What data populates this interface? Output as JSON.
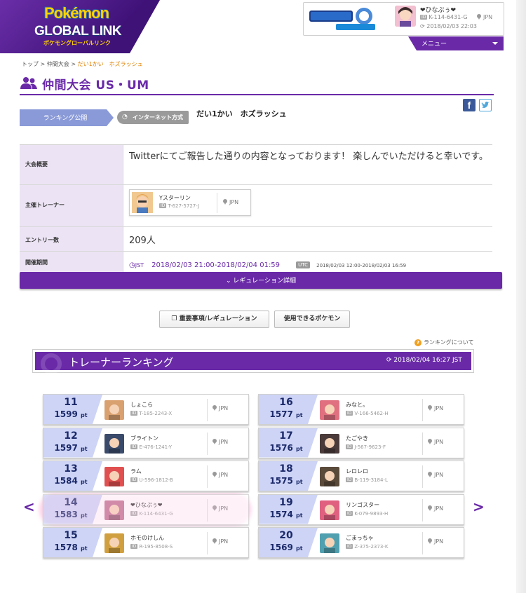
{
  "header": {
    "logo_top": "Pokémon",
    "logo_main": "GLOBAL LINK",
    "logo_sub": "ポケモングローバルリンク",
    "user": {
      "name": "❤ひなぷぅ❤",
      "id": "K-114-6431-G",
      "country": "JPN",
      "timestamp": "2018/02/03 22:03",
      "id_tag": "ID"
    },
    "menu_label": "メニュー"
  },
  "breadcrumb": {
    "top": "トップ",
    "sep": ">",
    "section": "仲間大会",
    "current": "だい1かい　ホズラッシュ"
  },
  "page": {
    "title": "仲間大会 US・UM"
  },
  "status": {
    "ranking_public": "ランキング公開",
    "network": "インターネット方式",
    "competition_name": "だい1かい　ホズラッシュ",
    "facebook": "f"
  },
  "info": {
    "overview_label": "大会概要",
    "overview": "Twitterにてご報告した通りの内容となっております！ 楽しんでいただけると幸いです。",
    "host_label": "主催トレーナー",
    "host": {
      "name": "Yスターリン",
      "id": "T-627-5727-J",
      "country": "JPN",
      "id_tag": "ID"
    },
    "entries_label": "エントリー数",
    "entries": "209人",
    "period_label": "開催期間",
    "period_jst_tag": "JST",
    "period_jst": "2018/02/03 21:00-2018/02/04 01:59",
    "period_utc_tag": "UTC",
    "period_utc": "2018/02/03 12:00-2018/02/03 16:59"
  },
  "regulation_detail": "レギュレーション詳細",
  "buttons": {
    "important": "重要事項/レギュレーション",
    "usable_pokemon": "使用できるポケモン"
  },
  "ranking": {
    "about": "ランキングについて",
    "title": "トレーナーランキング",
    "updated": "2018/02/04 16:27",
    "updated_tz": "JST",
    "pt_unit": "pt",
    "id_tag": "ID",
    "prev": "<",
    "next": ">",
    "left": [
      {
        "rank": "11",
        "points": "1599",
        "name": "しょこら",
        "id": "T-185-2243-X",
        "country": "JPN",
        "avatar_color": "#d9a070",
        "highlight": false
      },
      {
        "rank": "12",
        "points": "1597",
        "name": "ブライトン",
        "id": "E-476-1241-Y",
        "country": "JPN",
        "avatar_color": "#3a4a6a",
        "highlight": false
      },
      {
        "rank": "13",
        "points": "1584",
        "name": "ラム",
        "id": "U-596-1812-B",
        "country": "JPN",
        "avatar_color": "#e05050",
        "highlight": false
      },
      {
        "rank": "14",
        "points": "1583",
        "name": "❤ひなぷぅ❤",
        "id": "K-114-6431-G",
        "country": "JPN",
        "avatar_color": "#c07090",
        "highlight": true
      },
      {
        "rank": "15",
        "points": "1578",
        "name": "ホモのけしん",
        "id": "R-195-8508-S",
        "country": "JPN",
        "avatar_color": "#d0a040",
        "highlight": false
      }
    ],
    "right": [
      {
        "rank": "16",
        "points": "1577",
        "name": "みなと。",
        "id": "V-166-5462-H",
        "country": "JPN",
        "avatar_color": "#e07080",
        "highlight": false
      },
      {
        "rank": "17",
        "points": "1576",
        "name": "たごやき",
        "id": "J-567-9623-F",
        "country": "JPN",
        "avatar_color": "#4a3a3a",
        "highlight": false
      },
      {
        "rank": "18",
        "points": "1575",
        "name": "レロレロ",
        "id": "B-119-3184-L",
        "country": "JPN",
        "avatar_color": "#5a4a3a",
        "highlight": false
      },
      {
        "rank": "19",
        "points": "1574",
        "name": "リンゴスター",
        "id": "K-079-9893-H",
        "country": "JPN",
        "avatar_color": "#e06080",
        "highlight": false
      },
      {
        "rank": "20",
        "points": "1569",
        "name": "ごまっちゃ",
        "id": "Z-375-2373-K",
        "country": "JPN",
        "avatar_color": "#50a0b0",
        "highlight": false
      }
    ]
  },
  "colors": {
    "brand_purple": "#6a2aa8",
    "rank_badge": "#cdd4f6",
    "highlight": "#ffaad7"
  }
}
